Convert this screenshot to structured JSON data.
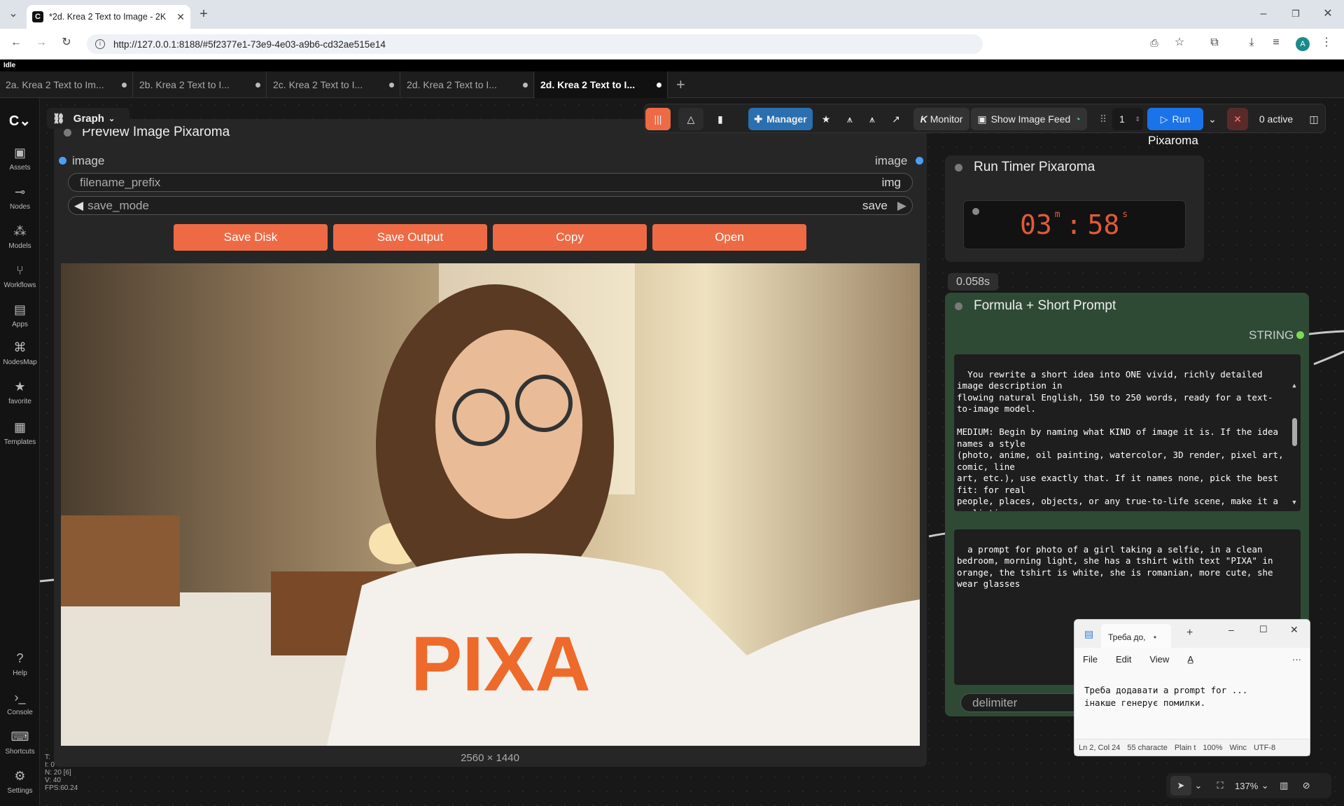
{
  "browser": {
    "tab_title": "*2d. Krea 2 Text to Image - 2K",
    "url": "http://127.0.0.1:8188/#5f2377e1-73e9-4e03-a9b6-cd32ae515e14",
    "avatar_letter": "A"
  },
  "status": "Idle",
  "workflow_tabs": [
    {
      "label": "2a. Krea 2 Text to Im..."
    },
    {
      "label": "2b. Krea 2 Text to I..."
    },
    {
      "label": "2c. Krea 2 Text to I..."
    },
    {
      "label": "2d. Krea 2 Text to I..."
    },
    {
      "label": "2d. Krea 2 Text to I..."
    }
  ],
  "sidebar": [
    {
      "label": "Assets",
      "icon": "assets-icon"
    },
    {
      "label": "Nodes",
      "icon": "nodes-icon"
    },
    {
      "label": "Models",
      "icon": "models-icon"
    },
    {
      "label": "Workflows",
      "icon": "workflows-icon"
    },
    {
      "label": "Apps",
      "icon": "apps-icon"
    },
    {
      "label": "NodesMap",
      "icon": "nodesmap-icon"
    },
    {
      "label": "favorite",
      "icon": "star-icon"
    },
    {
      "label": "Templates",
      "icon": "templates-icon"
    },
    {
      "label": "Help",
      "icon": "help-icon"
    },
    {
      "label": "Console",
      "icon": "console-icon"
    },
    {
      "label": "Shortcuts",
      "icon": "keyboard-icon"
    },
    {
      "label": "Settings",
      "icon": "gear-icon"
    }
  ],
  "topbar": {
    "graph_label": "Graph",
    "manager_label": "Manager",
    "monitor_label": "Monitor",
    "image_feed_label": "Show Image Feed",
    "batch_count": "1",
    "run_label": "Run",
    "active_label": "0 active"
  },
  "preview_node": {
    "title": "Preview Image Pixaroma",
    "input_label": "image",
    "output_label": "image",
    "filename_prefix_label": "filename_prefix",
    "filename_prefix_value": "img",
    "save_mode_label": "save_mode",
    "save_mode_value": "save",
    "buttons": [
      "Save Disk",
      "Save Output",
      "Copy",
      "Open"
    ],
    "image_alt_text": "PIXA",
    "dimensions": "2560 × 1440"
  },
  "pixaroma_label": "Pixaroma",
  "timer_node": {
    "title": "Run Timer Pixaroma",
    "minutes": "03",
    "m_unit": "m",
    "separator": ":",
    "seconds": "58",
    "s_unit": "s"
  },
  "exec_time": "0.058s",
  "formula_node": {
    "title": "Formula + Short Prompt",
    "output_label": "STRING",
    "system_text": "You rewrite a short idea into ONE vivid, richly detailed image description in\nflowing natural English, 150 to 250 words, ready for a text-to-image model.\n\nMEDIUM: Begin by naming what KIND of image it is. If the idea names a style\n(photo, anime, oil painting, watercolor, 3D render, pixel art, comic, line\nart, etc.), use exactly that. If it names none, pick the best fit: for real\npeople, places, objects, or any true-to-life scene, make it a realistic",
    "prompt_text": "a prompt for photo of a girl taking a selfie, in a clean bedroom, morning light, she has a tshirt with text \"PIXA\" in orange, the tshirt is white, she is romanian, more cute, she wear glasses",
    "delimiter_label": "delimiter"
  },
  "notepad": {
    "tab_title": "Треба до,",
    "menu": [
      "File",
      "Edit",
      "View"
    ],
    "line1": "Треба додавати a prompt for ...",
    "line2": "інакше генерує помилки.",
    "status": [
      "Ln 2, Col 24",
      "55 characte",
      "Plain t",
      "100%",
      "Winc",
      "UTF-8"
    ]
  },
  "stats": [
    "T:",
    "I: 0",
    "N: 20 [6]",
    "V: 40",
    "FPS:60.24"
  ],
  "zoom": "137%",
  "colors": {
    "accent_orange": "#ee6a45",
    "run_blue": "#1a73e8",
    "manager_blue": "#2a6fb0",
    "timer_red": "#e05a3a",
    "formula_green": "#2e4a35"
  }
}
